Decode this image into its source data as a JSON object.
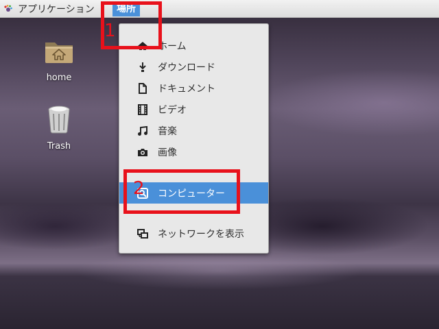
{
  "top_panel": {
    "applications_label": "アプリケーション",
    "places_label": "場所"
  },
  "desktop": {
    "icons": [
      {
        "label": "home",
        "icon": "home-folder-icon"
      },
      {
        "label": "Trash",
        "icon": "trash-icon"
      }
    ]
  },
  "places_menu": {
    "items": [
      {
        "label": "ホーム",
        "icon": "home-icon"
      },
      {
        "label": "ダウンロード",
        "icon": "download-icon"
      },
      {
        "label": "ドキュメント",
        "icon": "document-icon"
      },
      {
        "label": "ビデオ",
        "icon": "video-icon"
      },
      {
        "label": "音楽",
        "icon": "music-icon"
      },
      {
        "label": "画像",
        "icon": "camera-icon"
      },
      {
        "label": "コンピューター",
        "icon": "computer-icon",
        "selected": true
      },
      {
        "label": "ネットワークを表示",
        "icon": "network-icon"
      }
    ]
  },
  "annotations": {
    "first": "1",
    "second": "2"
  },
  "colors": {
    "highlight": "#4a90d9",
    "annotation": "#e8111b",
    "menu_bg": "#e8e8e8"
  }
}
